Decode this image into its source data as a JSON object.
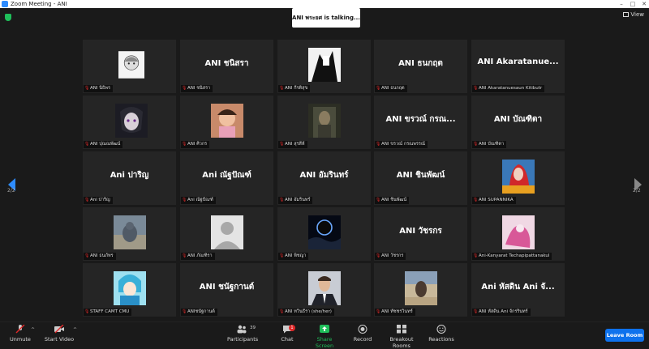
{
  "window": {
    "title": "Zoom Meeting - ANI"
  },
  "meeting": {
    "talking": "ANI พระยศ is talking...",
    "view_label": "View",
    "page_indicator_left": "2/2",
    "page_indicator_right": "2/2"
  },
  "tiles": [
    {
      "big": "",
      "label": "ANI นิธิพร",
      "pic": "anime-sketch"
    },
    {
      "big": "ANI ชนิสรา",
      "label": "ANI ชนิสรา",
      "pic": ""
    },
    {
      "big": "",
      "label": "ANI กีรติสุข",
      "pic": "manga-bw"
    },
    {
      "big": "ANI ธนกฤต",
      "label": "ANI ธนกฤต",
      "pic": ""
    },
    {
      "big": "ANI Akaratanue...",
      "label": "ANI Akaratanuesaun Kitibutr",
      "pic": ""
    },
    {
      "big": "",
      "label": "ANI ปุณณพัฒน์",
      "pic": "anime-dark"
    },
    {
      "big": "",
      "label": "ANI ศิวกร",
      "pic": "child-photo"
    },
    {
      "big": "",
      "label": "ANI สุรสีห์",
      "pic": "door-figure"
    },
    {
      "big": "ANI ขรวณ์ กรณ...",
      "label": "ANI ขรวณ์ กรณพรรณ์",
      "pic": ""
    },
    {
      "big": "ANI บัณฑิตา",
      "label": "ANI บัณฑิตา",
      "pic": ""
    },
    {
      "big": "Ani ปาริญ",
      "label": "Ani ปาริญ",
      "pic": ""
    },
    {
      "big": "Ani ณัฐปัณฑ์",
      "label": "Ani ณัฐปัณฑ์",
      "pic": ""
    },
    {
      "big": "ANI อัมรินทร์",
      "label": "ANI อัมรินทร์",
      "pic": ""
    },
    {
      "big": "ANI ชินพัฒน์",
      "label": "ANI ชินพัฒน์",
      "pic": ""
    },
    {
      "big": "",
      "label": "ANI SUPANNIKA",
      "pic": "anime-red"
    },
    {
      "big": "",
      "label": "ANI ธนภัทร",
      "pic": "seal-photo"
    },
    {
      "big": "",
      "label": "ANI ภัณฑิรา",
      "pic": "avatar-default"
    },
    {
      "big": "",
      "label": "ANI พิชญา",
      "pic": "eclipse"
    },
    {
      "big": "ANI วัชรกร",
      "label": "ANI วัชรกร",
      "pic": ""
    },
    {
      "big": "",
      "label": "Ani-Kanyarat Techapipattanakul",
      "pic": "pink-art"
    },
    {
      "big": "",
      "label": "STAFF CAMT CMU",
      "pic": "cyan-char"
    },
    {
      "big": "ANI ชนัฐกานต์",
      "label": "ANIชนัฐกานต์",
      "pic": ""
    },
    {
      "big": "",
      "label": "ANI ทวินธีรา (she/her)",
      "pic": "man-suit"
    },
    {
      "big": "",
      "label": "ANI ทัชชรวินทร์",
      "pic": "sand-figure"
    },
    {
      "big": "Ani หัสดิน Ani จั...",
      "label": "ANI หัสดิน Ani จักรรินทร์",
      "pic": ""
    }
  ],
  "toolbar": {
    "unmute": "Unmute",
    "start_video": "Start Video",
    "participants": "Participants",
    "participants_count": "39",
    "chat": "Chat",
    "chat_badge": "1",
    "share_screen": "Share Screen",
    "record": "Record",
    "breakout_rooms": "Breakout Rooms",
    "reactions": "Reactions",
    "leave": "Leave Room"
  },
  "colors": {
    "accent": "#2d8cff",
    "share": "#1fbf5a",
    "leave": "#0e72ed",
    "muted": "#e02828"
  }
}
